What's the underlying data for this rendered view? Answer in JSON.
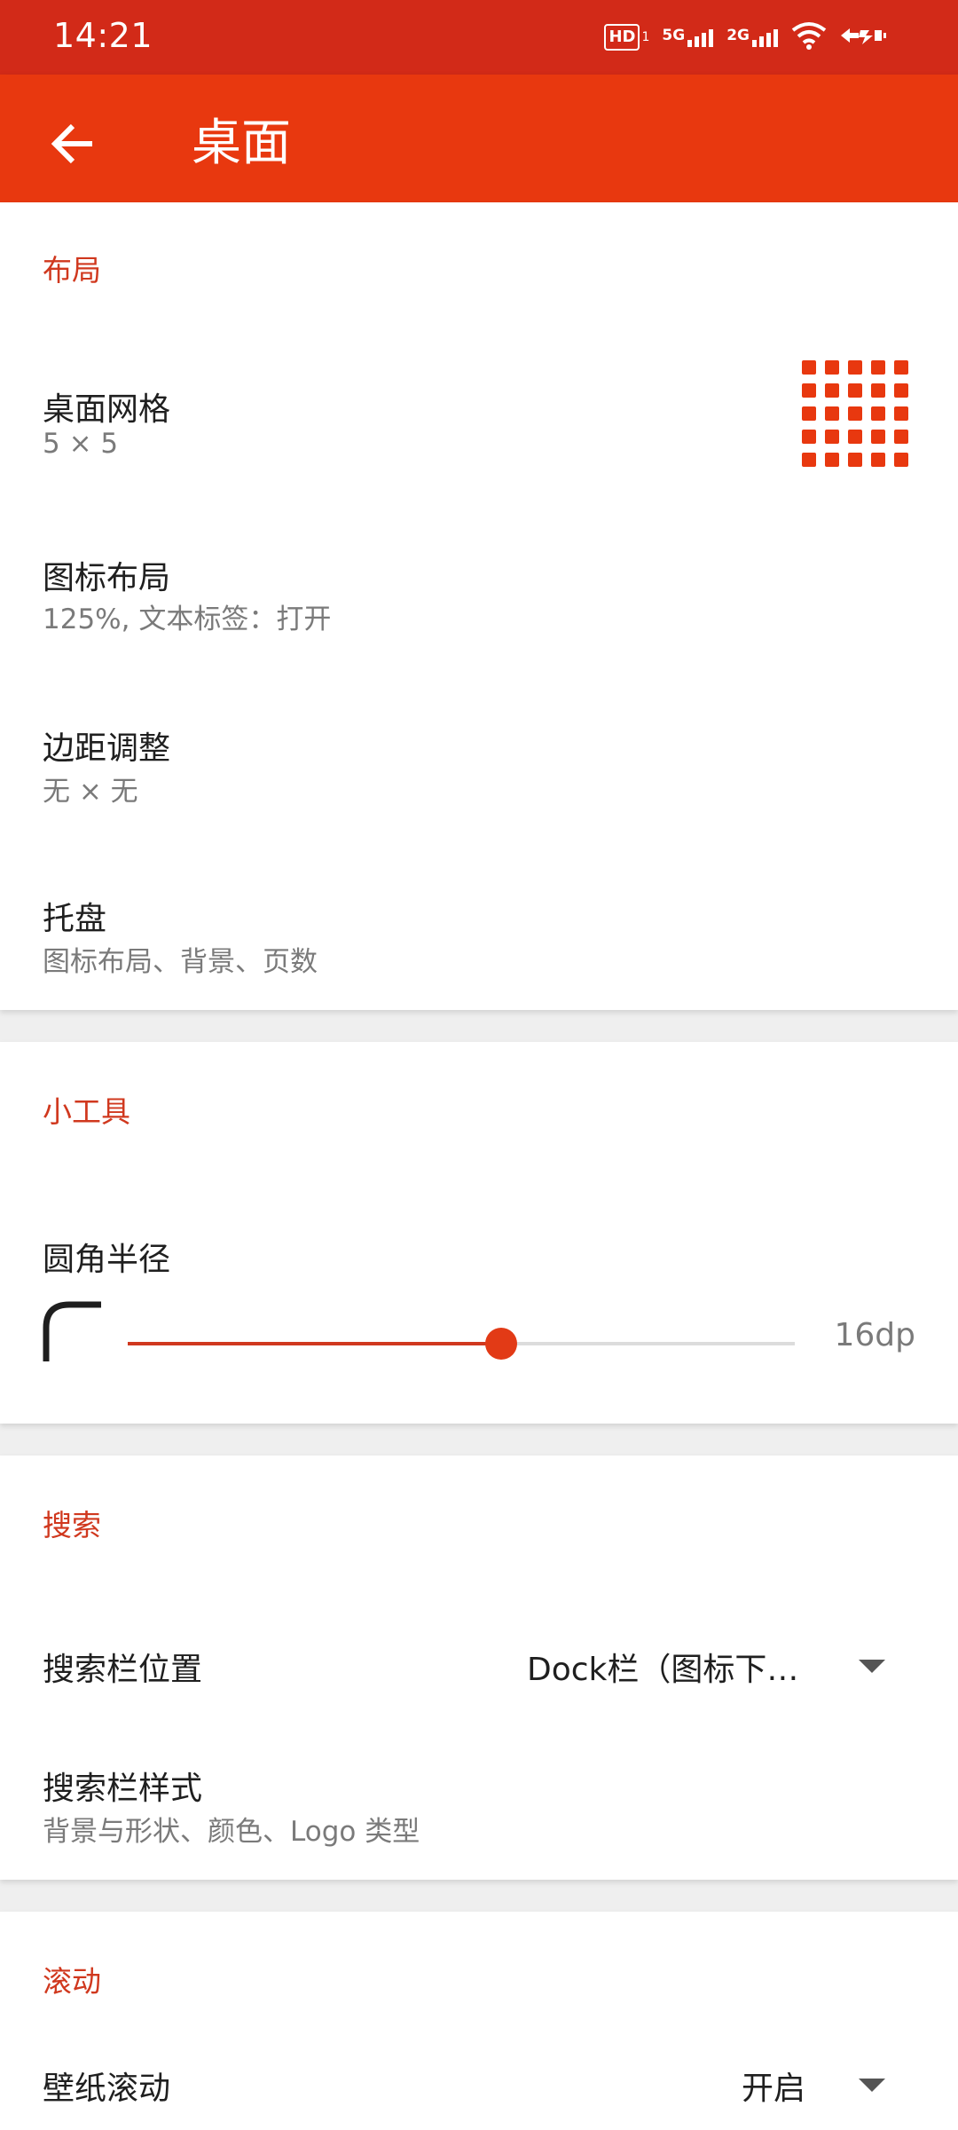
{
  "status": {
    "time": "14:21",
    "icons": [
      "hd-icon",
      "5g-signal-icon",
      "2g-signal-icon",
      "wifi-icon",
      "battery-charging-icon"
    ],
    "hd_label": "HD",
    "five_g_label": "5G",
    "two_g_label": "2G"
  },
  "appbar": {
    "title": "桌面",
    "accent_color": "#e8380f",
    "statusbar_color": "#d22a18"
  },
  "layout": {
    "header": "布局",
    "items": [
      {
        "title": "桌面网格",
        "subtitle": "5 × 5"
      },
      {
        "title": "图标布局",
        "subtitle": "125%, 文本标签：打开"
      },
      {
        "title": "边距调整",
        "subtitle": "无 × 无"
      },
      {
        "title": "托盘",
        "subtitle": "图标布局、背景、页数"
      }
    ]
  },
  "widgets": {
    "header": "小工具",
    "corner_radius": {
      "title": "圆角半径",
      "value_label": "16dp",
      "value": 16,
      "fraction": 0.56
    }
  },
  "search": {
    "header": "搜索",
    "position": {
      "title": "搜索栏位置",
      "value": "Dock栏（图标下…"
    },
    "style": {
      "title": "搜索栏样式",
      "subtitle": "背景与形状、颜色、Logo 类型"
    }
  },
  "scroll": {
    "header": "滚动",
    "wallpaper": {
      "title": "壁纸滚动",
      "value": "开启"
    }
  }
}
